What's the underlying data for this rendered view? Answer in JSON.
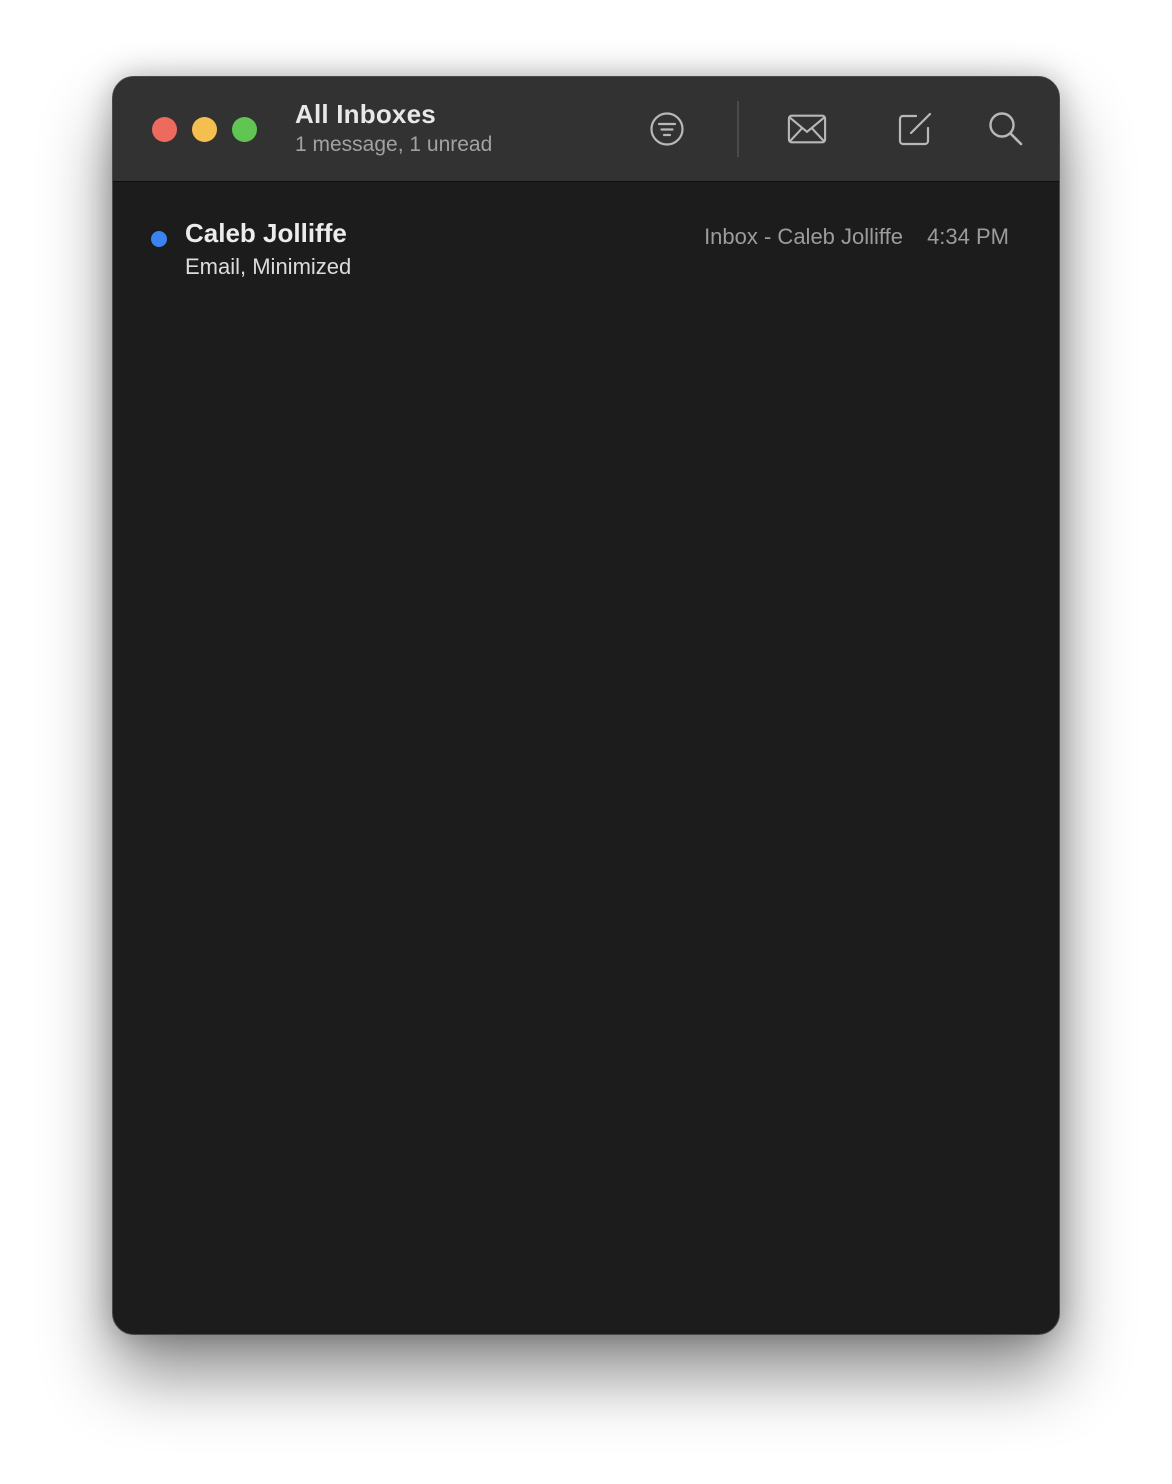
{
  "window": {
    "title": "All Inboxes",
    "subtitle": "1 message, 1 unread"
  },
  "toolbar": {
    "icons": [
      "filter-icon",
      "envelope-icon",
      "compose-icon",
      "search-icon"
    ]
  },
  "colors": {
    "window_bg": "#1c1c1c",
    "titlebar_bg": "#323232",
    "close": "#ed6a5e",
    "minimize": "#f5bf4f",
    "maximize": "#61c554",
    "unread_dot": "#3a84f0"
  },
  "messages": [
    {
      "sender": "Caleb Jolliffe",
      "subject": "Email, Minimized",
      "mailbox": "Inbox - Caleb Jolliffe",
      "time": "4:34 PM",
      "unread": true
    }
  ]
}
